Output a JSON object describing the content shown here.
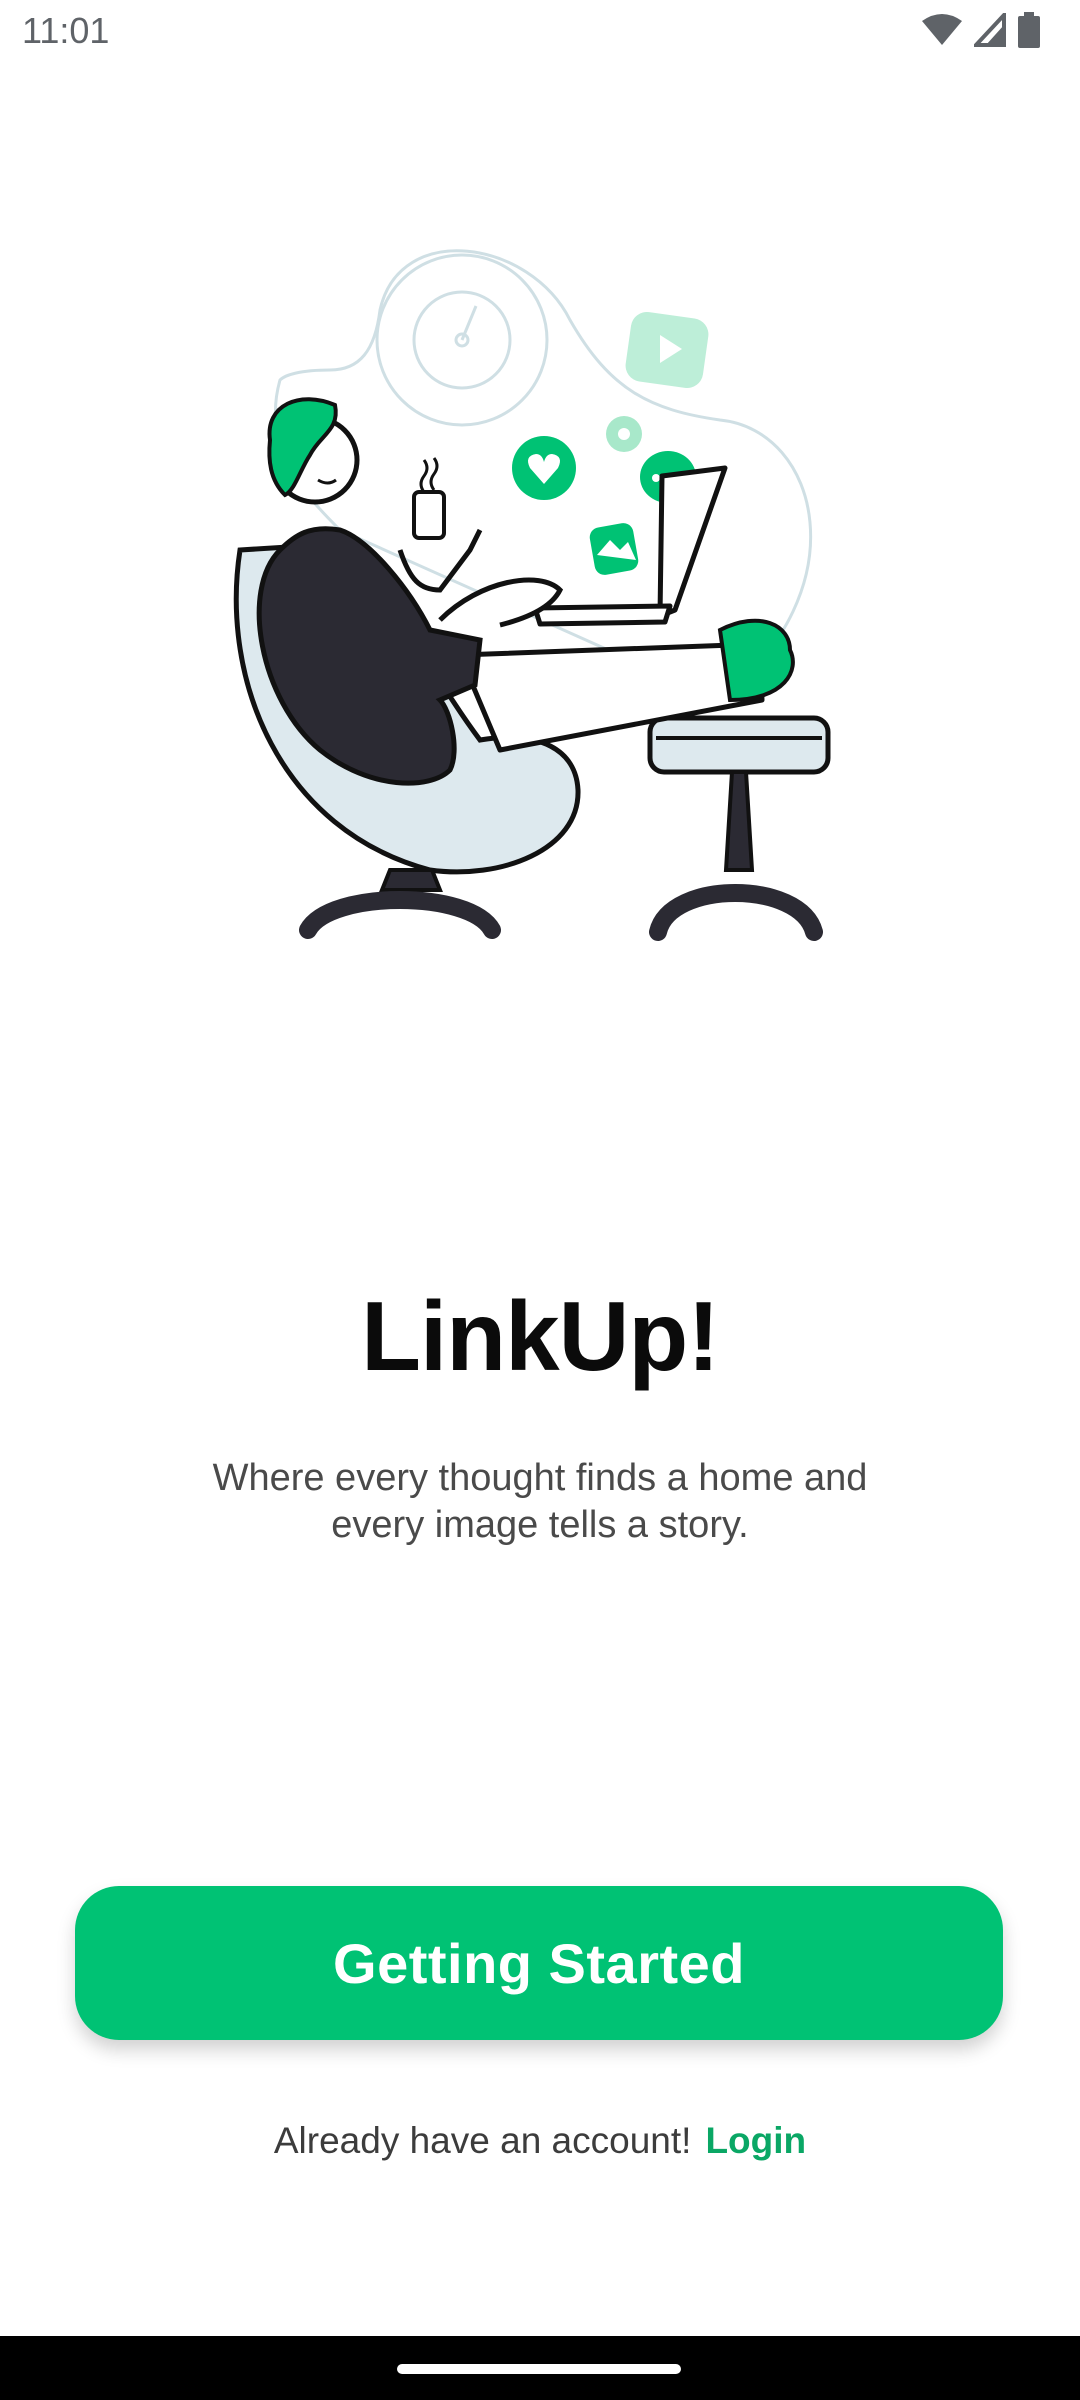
{
  "status_bar": {
    "time": "11:01",
    "icons": [
      "wifi-icon",
      "cell-signal-icon",
      "battery-icon"
    ]
  },
  "app": {
    "title": "LinkUp!",
    "tagline_line1": "Where every thought finds a home and",
    "tagline_line2": "every image tells a story."
  },
  "cta": {
    "label": "Getting Started"
  },
  "login": {
    "prompt": "Already have an account!",
    "link": "Login"
  },
  "colors": {
    "accent": "#00c274",
    "link": "#0aa765",
    "text": "#0b0b0b"
  }
}
